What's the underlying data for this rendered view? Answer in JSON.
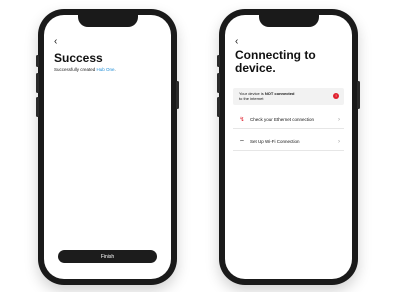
{
  "success_screen": {
    "back": "‹",
    "title": "Success",
    "subtitle_prefix": "Successfully created ",
    "subtitle_link": "Hub One",
    "subtitle_suffix": ".",
    "finish_label": "Finish"
  },
  "connecting_screen": {
    "back": "‹",
    "title": "Connecting to device.",
    "status_prefix": "Your device is ",
    "status_bold": "NOT connected",
    "status_suffix": "to the internet",
    "alert_glyph": "!",
    "items": [
      {
        "label": "Check your Ethernet connection",
        "icon": "ethernet-icon",
        "glyph": "↯",
        "chevron": "›"
      },
      {
        "label": "Set Up Wi-Fi Connection",
        "icon": "wifi-icon",
        "glyph": "⌔",
        "chevron": "›"
      }
    ]
  },
  "colors": {
    "accent_link": "#1a8bd6",
    "alert_red": "#e0212e",
    "phone_body": "#1a1a1a"
  }
}
